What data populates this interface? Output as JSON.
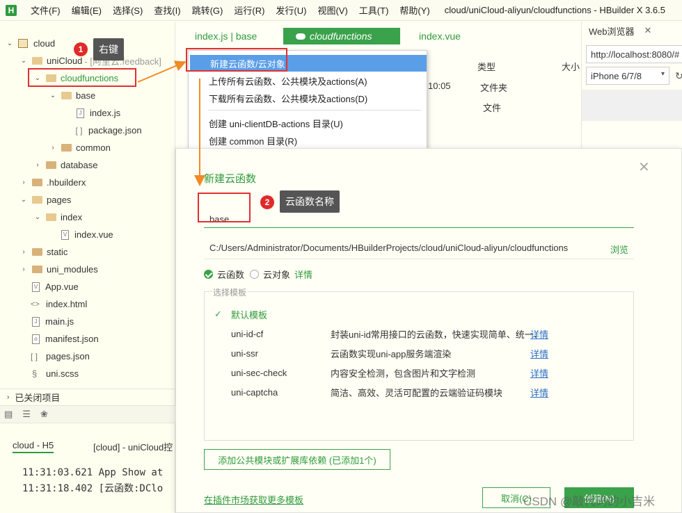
{
  "app": {
    "logo": "H",
    "window_title": "cloud/uniCloud-aliyun/cloudfunctions - HBuilder X 3.6.5",
    "menu": [
      "文件(F)",
      "编辑(E)",
      "选择(S)",
      "查找(I)",
      "跳转(G)",
      "运行(R)",
      "发行(U)",
      "视图(V)",
      "工具(T)",
      "帮助(Y)"
    ]
  },
  "sidebar": {
    "tree": [
      {
        "label": "cloud",
        "suffix": ""
      },
      {
        "label": "uniCloud",
        "suffix": "- [阿里云:feedback]"
      },
      {
        "label": "cloudfunctions",
        "suffix": ""
      },
      {
        "label": "base",
        "suffix": ""
      },
      {
        "label": "index.js",
        "suffix": ""
      },
      {
        "label": "package.json",
        "suffix": ""
      },
      {
        "label": "common",
        "suffix": ""
      },
      {
        "label": "database",
        "suffix": ""
      },
      {
        "label": ".hbuilderx",
        "suffix": ""
      },
      {
        "label": "pages",
        "suffix": ""
      },
      {
        "label": "index",
        "suffix": ""
      },
      {
        "label": "index.vue",
        "suffix": ""
      },
      {
        "label": "static",
        "suffix": ""
      },
      {
        "label": "uni_modules",
        "suffix": ""
      },
      {
        "label": "App.vue",
        "suffix": ""
      },
      {
        "label": "index.html",
        "suffix": ""
      },
      {
        "label": "main.js",
        "suffix": ""
      },
      {
        "label": "manifest.json",
        "suffix": ""
      },
      {
        "label": "pages.json",
        "suffix": ""
      },
      {
        "label": "uni.scss",
        "suffix": ""
      }
    ],
    "closed_projects": "已关闭项目"
  },
  "console": {
    "tabs": [
      "cloud - H5",
      "[cloud] - uniCloud控"
    ],
    "lines": [
      "11:31:03.621 App Show  at",
      "11:31:18.402 [云函数:DClo"
    ]
  },
  "editor": {
    "tabs": [
      "index.js | base",
      "cloudfunctions",
      "index.vue"
    ],
    "columns": {
      "type": "类型",
      "size": "大小"
    },
    "cells": {
      "time": "10:05",
      "folder": "文件夹",
      "file": "文件"
    }
  },
  "browser": {
    "tab": "Web浏览器",
    "url": "http://localhost:8080/#",
    "device": "iPhone 6/7/8"
  },
  "context_menu": {
    "items": [
      "新建云函数/云对象",
      "上传所有云函数、公共模块及actions(A)",
      "下载所有云函数、公共模块及actions(D)",
      "创建 uni-clientDB-actions 目录(U)",
      "创建 common 目录(R)"
    ]
  },
  "dialog": {
    "title": "新建云函数",
    "name_value": "base",
    "path": "C:/Users/Administrator/Documents/HBuilderProjects/cloud/uniCloud-aliyun/cloudfunctions",
    "browse": "浏览",
    "type_function": "云函数",
    "type_object": "云对象",
    "type_detail": "详情",
    "template_legend": "选择模板",
    "templates": [
      {
        "name": "默认模板",
        "desc": "",
        "detail": ""
      },
      {
        "name": "uni-id-cf",
        "desc": "封装uni-id常用接口的云函数，快速实现简单、统一、",
        "detail": "详情"
      },
      {
        "name": "uni-ssr",
        "desc": "云函数实现uni-app服务端渲染",
        "detail": "详情"
      },
      {
        "name": "uni-sec-check",
        "desc": "内容安全检测，包含图片和文字检测",
        "detail": "详情"
      },
      {
        "name": "uni-captcha",
        "desc": "简洁、高效、灵活可配置的云端验证码模块",
        "detail": "详情"
      }
    ],
    "dep_button": "添加公共模块或扩展库依赖 (已添加1个)",
    "market_link": "在插件市场获取更多模板",
    "cancel": "取消(C)",
    "create": "创建(N)"
  },
  "annotations": {
    "badge1": "1",
    "callout1": "右键",
    "badge2": "2",
    "callout2": "云函数名称"
  },
  "watermark": "CSDN @敲代码的小吉米",
  "colors": {
    "accent": "#3aa24a",
    "highlight": "#5a9ee8",
    "annotation": "#e02a2a"
  }
}
